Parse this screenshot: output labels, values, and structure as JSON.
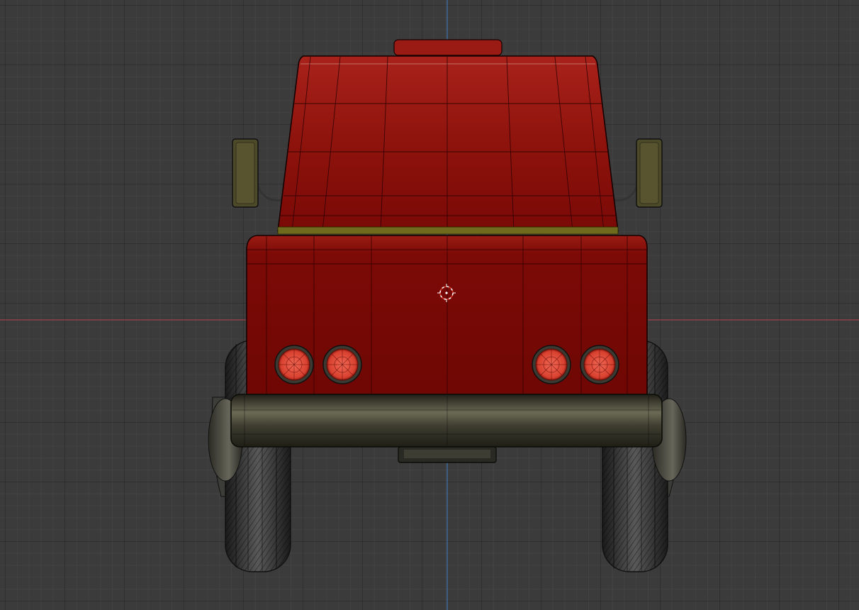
{
  "viewport": {
    "view": "back-orthographic",
    "background_color": "#3b3b3b",
    "grid_color": "#2e2e2e",
    "axis_x_color": "#b6434d",
    "axis_z_color": "#3d7cc9"
  },
  "model": {
    "object": "truck",
    "body_color": "#7a0a08",
    "body_highlight_color": "#a21d17",
    "wire_color": "#1a0000",
    "bumper_color": "#4a4a3a",
    "mirror_color": "#4d4a2a",
    "trim_color": "#6f6a1e",
    "tail_light_color": "#e8533f",
    "tire_color": "#2c2c2c"
  },
  "cursor": {
    "icon": "3d-cursor-icon"
  }
}
